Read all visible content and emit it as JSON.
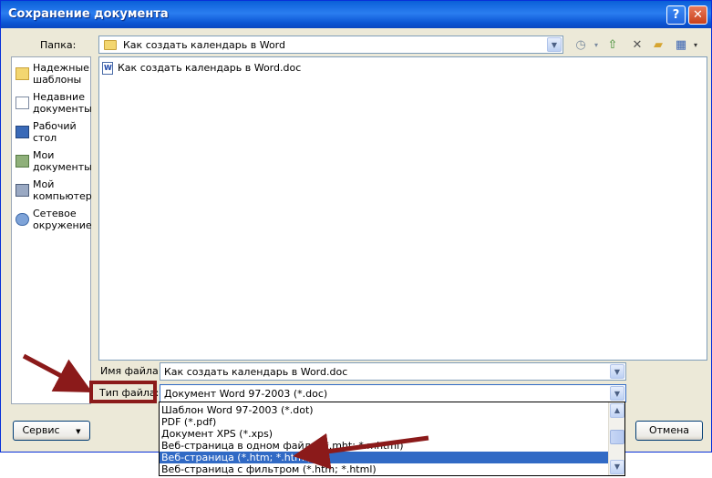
{
  "window": {
    "title": "Сохранение документа",
    "help_label": "?",
    "close_label": "✕"
  },
  "folder": {
    "label": "Папка:",
    "value": "Как создать календарь в Word",
    "icon": "folder-icon"
  },
  "places": [
    {
      "label": "Надежные шаблоны",
      "icon": "trusted-templates-icon"
    },
    {
      "label": "Недавние документы",
      "icon": "recent-documents-icon"
    },
    {
      "label": "Рабочий стол",
      "icon": "desktop-icon"
    },
    {
      "label": "Мои документы",
      "icon": "my-documents-icon"
    },
    {
      "label": "Мой компьютер",
      "icon": "my-computer-icon"
    },
    {
      "label": "Сетевое окружение",
      "icon": "network-icon"
    }
  ],
  "files": [
    {
      "name": "Как создать календарь в Word.doc",
      "icon": "word-doc-icon"
    }
  ],
  "filename": {
    "label": "Имя файла:",
    "value": "Как создать календарь в Word.doc"
  },
  "filetype": {
    "label": "Тип файла:",
    "value": "Документ Word 97-2003 (*.doc)",
    "options": [
      "Шаблон Word 97-2003 (*.dot)",
      "PDF (*.pdf)",
      "Документ XPS (*.xps)",
      "Веб-страница в одном файле (*.mht; *.mhtml)",
      "Веб-страница (*.htm; *.html)",
      "Веб-страница с фильтром (*.htm; *.html)"
    ],
    "selected_index": 4
  },
  "buttons": {
    "service": "Сервис",
    "cancel": "Отмена"
  },
  "colors": {
    "title_bar": "#0a5fd8",
    "selection": "#316ac5",
    "annotation": "#8b1a1a"
  }
}
